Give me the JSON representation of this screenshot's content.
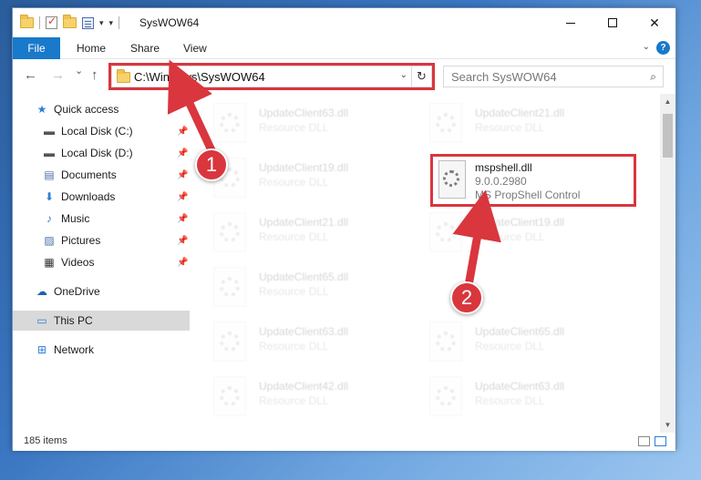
{
  "window": {
    "title": "SysWOW64",
    "min_icon": "minimize-icon",
    "max_icon": "maximize-icon",
    "close_symbol": "✕"
  },
  "ribbon": {
    "file": "File",
    "tabs": [
      "Home",
      "Share",
      "View"
    ]
  },
  "navigation": {
    "back": "←",
    "forward": "→",
    "recent": "⌄",
    "up": "↑",
    "address": "C:\\Windows\\SysWOW64",
    "refresh": "↻",
    "dropdown": "⌄",
    "search_placeholder": "Search SysWOW64",
    "search_icon": "⌕"
  },
  "sidebar": {
    "items": [
      {
        "label": "Quick access",
        "icon": "star-icon",
        "glyph": "★",
        "color": "#2f7dd6",
        "pinned": false
      },
      {
        "label": "Local Disk (C:)",
        "icon": "drive-icon",
        "glyph": "▬",
        "color": "#555555",
        "pinned": true
      },
      {
        "label": "Local Disk (D:)",
        "icon": "drive-icon",
        "glyph": "▬",
        "color": "#555555",
        "pinned": true
      },
      {
        "label": "Documents",
        "icon": "documents-icon",
        "glyph": "▤",
        "color": "#4a6ea8",
        "pinned": true
      },
      {
        "label": "Downloads",
        "icon": "download-arrow-icon",
        "glyph": "⬇",
        "color": "#2f7dd6",
        "pinned": true
      },
      {
        "label": "Music",
        "icon": "music-note-icon",
        "glyph": "♪",
        "color": "#2f7dd6",
        "pinned": true
      },
      {
        "label": "Pictures",
        "icon": "pictures-icon",
        "glyph": "▨",
        "color": "#4a6ea8",
        "pinned": true
      },
      {
        "label": "Videos",
        "icon": "film-icon",
        "glyph": "▦",
        "color": "#333333",
        "pinned": true
      },
      {
        "label": "OneDrive",
        "icon": "cloud-icon",
        "glyph": "☁",
        "color": "#1e5fb3",
        "pinned": false
      },
      {
        "label": "This PC",
        "icon": "computer-icon",
        "glyph": "▭",
        "color": "#2f7dd6",
        "pinned": false
      },
      {
        "label": "Network",
        "icon": "network-icon",
        "glyph": "⊞",
        "color": "#2f7dd6",
        "pinned": false
      }
    ],
    "pin_glyph": "📌"
  },
  "files": {
    "left_column": [
      {
        "name": "UpdateClient63.dll",
        "desc": "Resource DLL"
      },
      {
        "name": "UpdateClient19.dll",
        "desc": "Resource DLL"
      },
      {
        "name": "UpdateClient21.dll",
        "desc": "Resource DLL"
      },
      {
        "name": "UpdateClient65.dll",
        "desc": "Resource DLL"
      },
      {
        "name": "UpdateClient63.dll",
        "desc": "Resource DLL"
      },
      {
        "name": "UpdateClient42.dll",
        "desc": "Resource DLL"
      }
    ],
    "right_column": [
      {
        "name": "UpdateClient21.dll",
        "desc": "Resource DLL"
      },
      {
        "name": "UpdateClient19.dll",
        "desc": "Resource DLL"
      },
      {
        "name": "UpdateClient65.dll",
        "desc": "Resource DLL"
      },
      {
        "name": "UpdateClient63.dll",
        "desc": "Resource DLL"
      }
    ],
    "highlighted": {
      "name": "mspshell.dll",
      "version": "9.0.0.2980",
      "desc": "MS PropShell Control"
    }
  },
  "statusbar": {
    "count": "185 items"
  },
  "annotations": {
    "step1": "1",
    "step2": "2",
    "color": "#d9363e"
  }
}
